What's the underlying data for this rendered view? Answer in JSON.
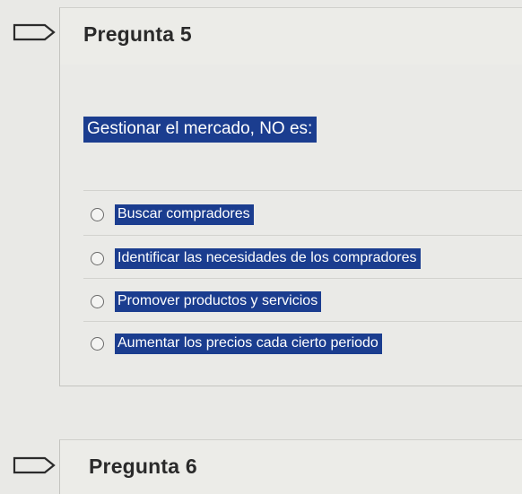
{
  "question5": {
    "title": "Pregunta 5",
    "prompt": "Gestionar el mercado,  NO es:",
    "options": [
      {
        "label": "Buscar compradores"
      },
      {
        "label": "Identificar las necesidades de los compradores"
      },
      {
        "label": "Promover productos y servicios"
      },
      {
        "label": "Aumentar los precios cada cierto periodo"
      }
    ]
  },
  "question6": {
    "title": "Pregunta 6"
  },
  "colors": {
    "highlight": "#1b3d8f",
    "background": "#e9e9e6"
  },
  "icons": {
    "flag": "flag-outline-icon",
    "radio": "radio-unchecked-icon"
  }
}
